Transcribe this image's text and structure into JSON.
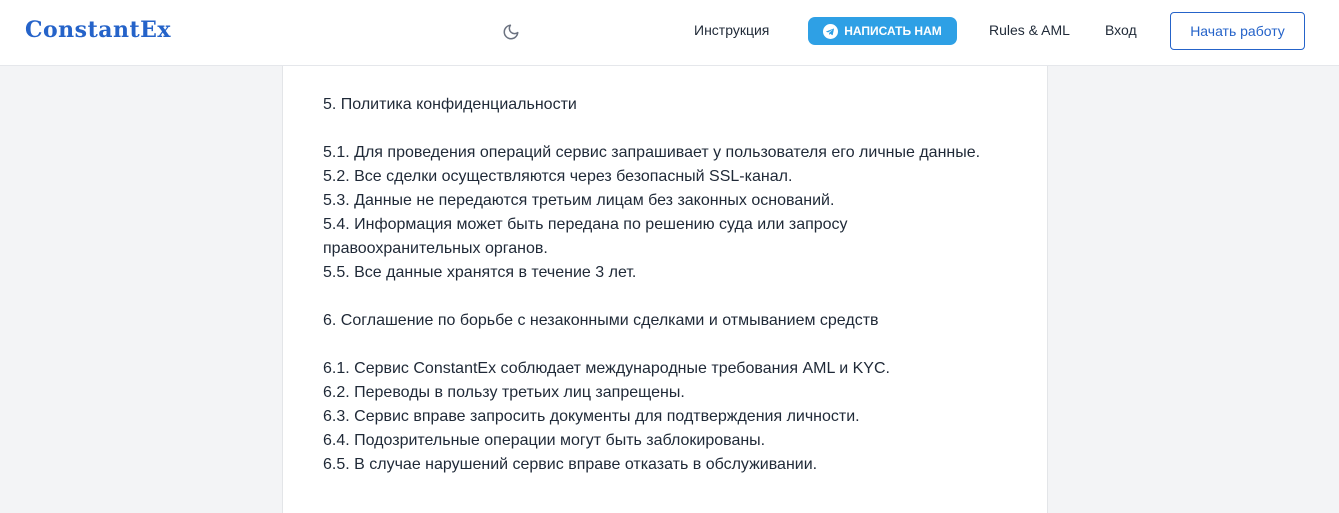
{
  "header": {
    "logo": "ConstantEx",
    "theme_icon": "moon-icon",
    "nav": {
      "instruction": "Инструкция",
      "write_us": "НАПИСАТЬ НАМ",
      "write_us_icon": "telegram-icon",
      "rules": "Rules & AML",
      "login": "Вход",
      "start": "Начать работу"
    },
    "colors": {
      "brand": "#2563c9",
      "telegram": "#2ea0e5"
    }
  },
  "content": {
    "section5": {
      "heading": "5. Политика конфиденциальности",
      "items": [
        "5.1. Для проведения операций сервис запрашивает у пользователя его личные данные.",
        "5.2. Все сделки осуществляются через безопасный SSL-канал.",
        "5.3. Данные не передаются третьим лицам без законных оснований.",
        "5.4. Информация может быть передана по решению суда или запросу правоохранительных органов.",
        "5.5. Все данные хранятся в течение 3 лет."
      ]
    },
    "section6": {
      "heading": "6. Соглашение по борьбе с незаконными сделками и отмыванием средств",
      "items": [
        "6.1. Сервис ConstantEx соблюдает международные требования AML и KYC.",
        "6.2. Переводы в пользу третьих лиц запрещены.",
        "6.3. Сервис вправе запросить документы для подтверждения личности.",
        "6.4. Подозрительные операции могут быть заблокированы.",
        "6.5. В случае нарушений сервис вправе отказать в обслуживании."
      ]
    }
  }
}
